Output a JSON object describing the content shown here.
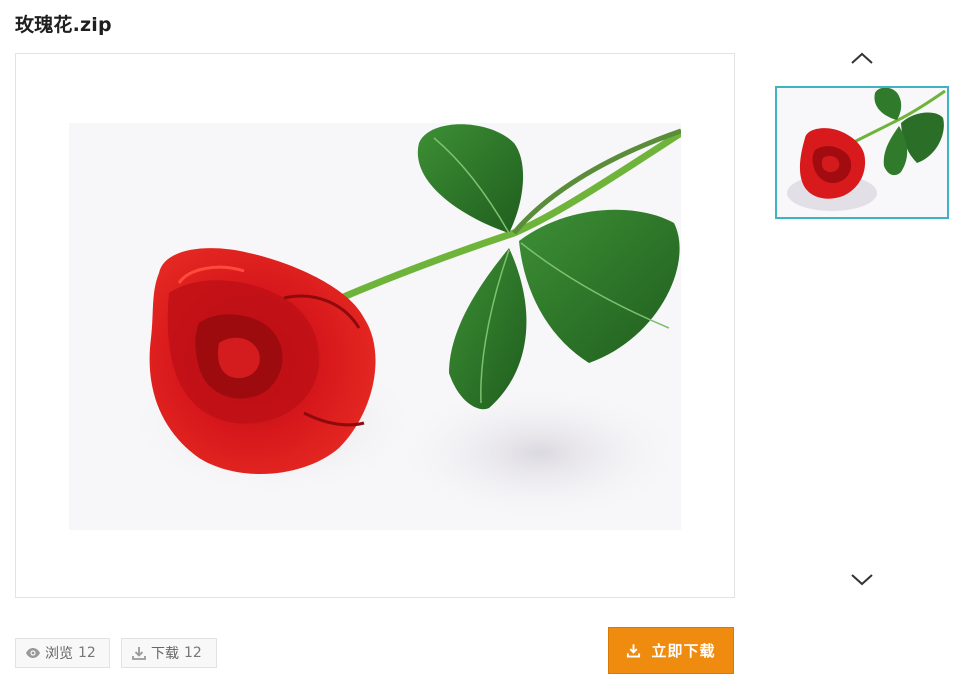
{
  "file": {
    "title": "玫瑰花.zip"
  },
  "preview": {
    "main_image": "red-rose-photo",
    "thumbnail": "red-rose-photo-thumbnail",
    "thumbnail_border_color": "#3fb3c4"
  },
  "stats": {
    "views_label": "浏览",
    "views_count": "12",
    "downloads_label": "下载",
    "downloads_count": "12"
  },
  "actions": {
    "download_label": "立即下载",
    "download_color": "#ef8b0e"
  },
  "icons": {
    "scroll_up": "chevron-up-icon",
    "scroll_down": "chevron-down-icon",
    "views": "eye-icon",
    "downloads": "download-icon"
  }
}
